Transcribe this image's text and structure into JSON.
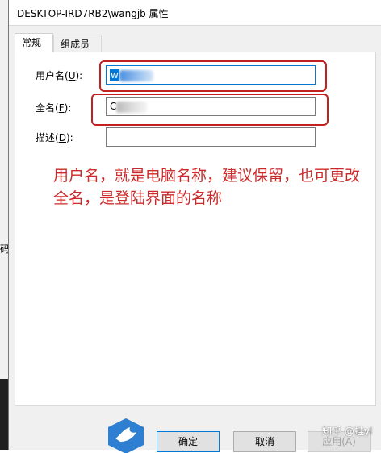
{
  "window": {
    "title": "DESKTOP-IRD7RB2\\wangjb 属性"
  },
  "tabs": [
    {
      "label": "常规"
    },
    {
      "label": "组成员"
    }
  ],
  "form": {
    "username_label": "用户名(",
    "username_key": "U",
    "fullname_label": "全名(",
    "fullname_key": "F",
    "description_label": "描述(",
    "description_key": "D",
    "label_suffix": "):",
    "username_value": "w",
    "fullname_value": "C",
    "description_value": ""
  },
  "annotation": {
    "line1": "用户名，就是电脑名称，建议保留，也可更改",
    "line2": "全名，是登陆界面的名称"
  },
  "buttons": {
    "ok": "确定",
    "cancel": "取消",
    "apply": "应用(A)"
  },
  "watermark": "知乎 @蛙yl",
  "background_fragment": "码",
  "colors": {
    "annotation": "#cc2a2a",
    "selection": "#0078d7"
  }
}
